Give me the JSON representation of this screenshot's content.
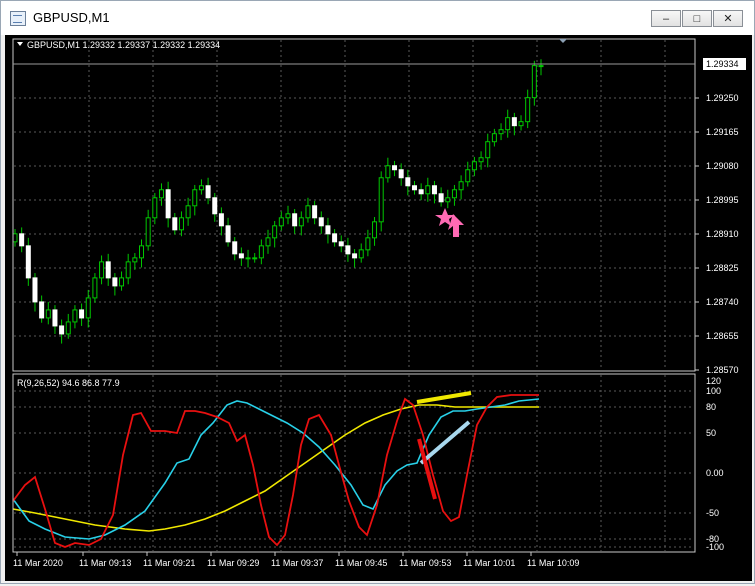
{
  "window": {
    "title": "GBPUSD,M1",
    "buttons": {
      "minimize": "–",
      "maximize": "□",
      "close": "✕"
    }
  },
  "colors": {
    "background": "#000000",
    "grid": "#5a5a5a",
    "candle": "#00c800",
    "price_line": "#9a9a9a",
    "indicator_red": "#e81010",
    "indicator_cyan": "#28d0e8",
    "indicator_yellow": "#f0e800",
    "arrow": "#ff6ab4"
  },
  "price_chart": {
    "header": "GBPUSD,M1  1.29332 1.29337 1.29332 1.29334",
    "current_price": "1.29334",
    "y_labels": [
      "1.29250",
      "1.29165",
      "1.29080",
      "1.28995",
      "1.28910",
      "1.28825",
      "1.28740",
      "1.28655",
      "1.28570"
    ]
  },
  "indicator_panel": {
    "header": "R(9,26,52) 94.6 86.8 77.9",
    "y_labels": [
      "120",
      "100",
      "80",
      "50",
      "0.00",
      "-50",
      "-80",
      "-100"
    ]
  },
  "time_axis": {
    "labels": [
      "11 Mar 2020",
      "11 Mar 09:13",
      "11 Mar 09:21",
      "11 Mar 09:29",
      "11 Mar 09:37",
      "11 Mar 09:45",
      "11 Mar 09:53",
      "11 Mar 10:01",
      "11 Mar 10:09"
    ]
  },
  "chart_data": {
    "type": "candlestick",
    "symbol": "GBPUSD",
    "timeframe": "M1",
    "candles_close_approx": [
      1.2891,
      1.2888,
      1.288,
      1.2874,
      1.287,
      1.2872,
      1.2868,
      1.2866,
      1.2869,
      1.2872,
      1.287,
      1.2875,
      1.288,
      1.2884,
      1.288,
      1.2878,
      1.288,
      1.2884,
      1.2885,
      1.2888,
      1.2895,
      1.29,
      1.2902,
      1.2895,
      1.2892,
      1.2895,
      1.2898,
      1.2902,
      1.2903,
      1.29,
      1.2896,
      1.2893,
      1.2889,
      1.2886,
      1.2885,
      1.2885,
      1.2885,
      1.2888,
      1.289,
      1.2893,
      1.2895,
      1.2896,
      1.2893,
      1.2895,
      1.2898,
      1.2895,
      1.2893,
      1.2891,
      1.2889,
      1.2888,
      1.2886,
      1.2885,
      1.2887,
      1.289,
      1.2894,
      1.2905,
      1.2908,
      1.2907,
      1.2905,
      1.2903,
      1.2902,
      1.2901,
      1.2903,
      1.2901,
      1.2899,
      1.29,
      1.2902,
      1.2904,
      1.2907,
      1.2909,
      1.291,
      1.2914,
      1.2916,
      1.2917,
      1.292,
      1.2918,
      1.2919,
      1.2925,
      1.2933,
      1.2933
    ],
    "price_ylim": [
      1.2857,
      1.29334
    ],
    "indicator": {
      "name": "R(9,26,52)",
      "values": [
        94.6,
        86.8,
        77.9
      ],
      "ylim": [
        -100,
        120
      ],
      "levels": [
        120,
        100,
        80,
        50,
        0,
        -50,
        -80,
        -100
      ]
    }
  }
}
